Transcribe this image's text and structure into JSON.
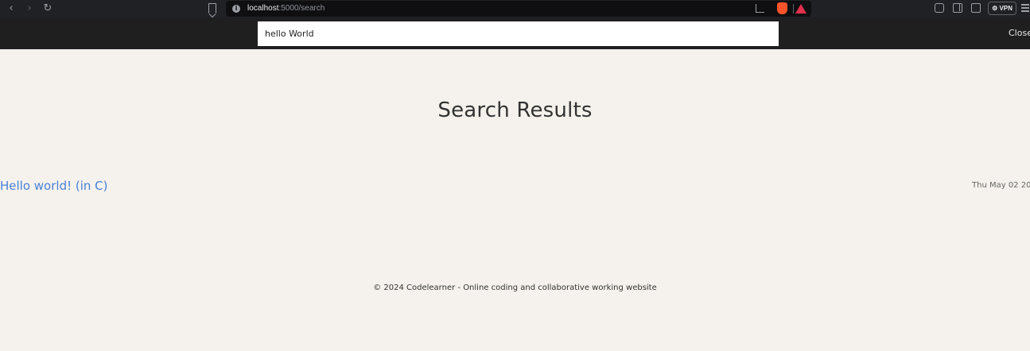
{
  "browser": {
    "url_host": "localhost",
    "url_path": ":5000/search",
    "vpn_label": "⚙ VPN",
    "icons": [
      "back-icon",
      "forward-icon",
      "reload-icon",
      "bookmark-icon",
      "site-info-icon",
      "share-icon",
      "brave-shields-icon",
      "brave-rewards-icon",
      "extensions-icon",
      "sidebar-icon",
      "wallet-icon",
      "menu-icon"
    ]
  },
  "header": {
    "search_value": "hello World",
    "close_label": "Close"
  },
  "main": {
    "title": "Search Results",
    "results": [
      {
        "title": "Hello world! (in C)",
        "date": "Thu May 02 20"
      }
    ]
  },
  "footer": {
    "text": "© 2024 Codelearner - Online coding and collaborative working website"
  },
  "colors": {
    "page_background": "#f5f2ed",
    "header_background": "#1f1f1f",
    "link": "#4a7fd6"
  }
}
